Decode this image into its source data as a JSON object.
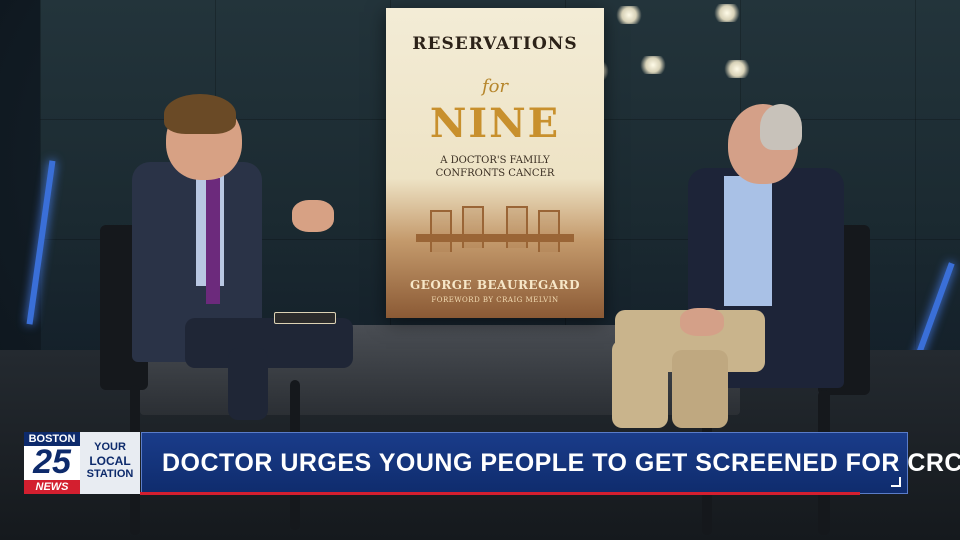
{
  "book": {
    "title_line1": "RESERVATIONS",
    "title_line2": "for",
    "title_line3": "NINE",
    "subtitle_line1": "A DOCTOR'S FAMILY",
    "subtitle_line2": "CONFRONTS CANCER",
    "author": "GEORGE BEAUREGARD",
    "foreword": "FOREWORD BY CRAIG MELVIN"
  },
  "lower_third": {
    "logo_top": "BOSTON",
    "logo_number": "25",
    "logo_bottom": "NEWS",
    "station_line1": "YOUR",
    "station_line2": "LOCAL",
    "station_line3": "STATION",
    "headline": "DOCTOR URGES YOUNG PEOPLE TO GET SCREENED FOR CRC"
  },
  "colors": {
    "headline_bar": "#0f2c6d",
    "accent_red": "#d31f2f",
    "logo_blue": "#0d2a6b"
  }
}
